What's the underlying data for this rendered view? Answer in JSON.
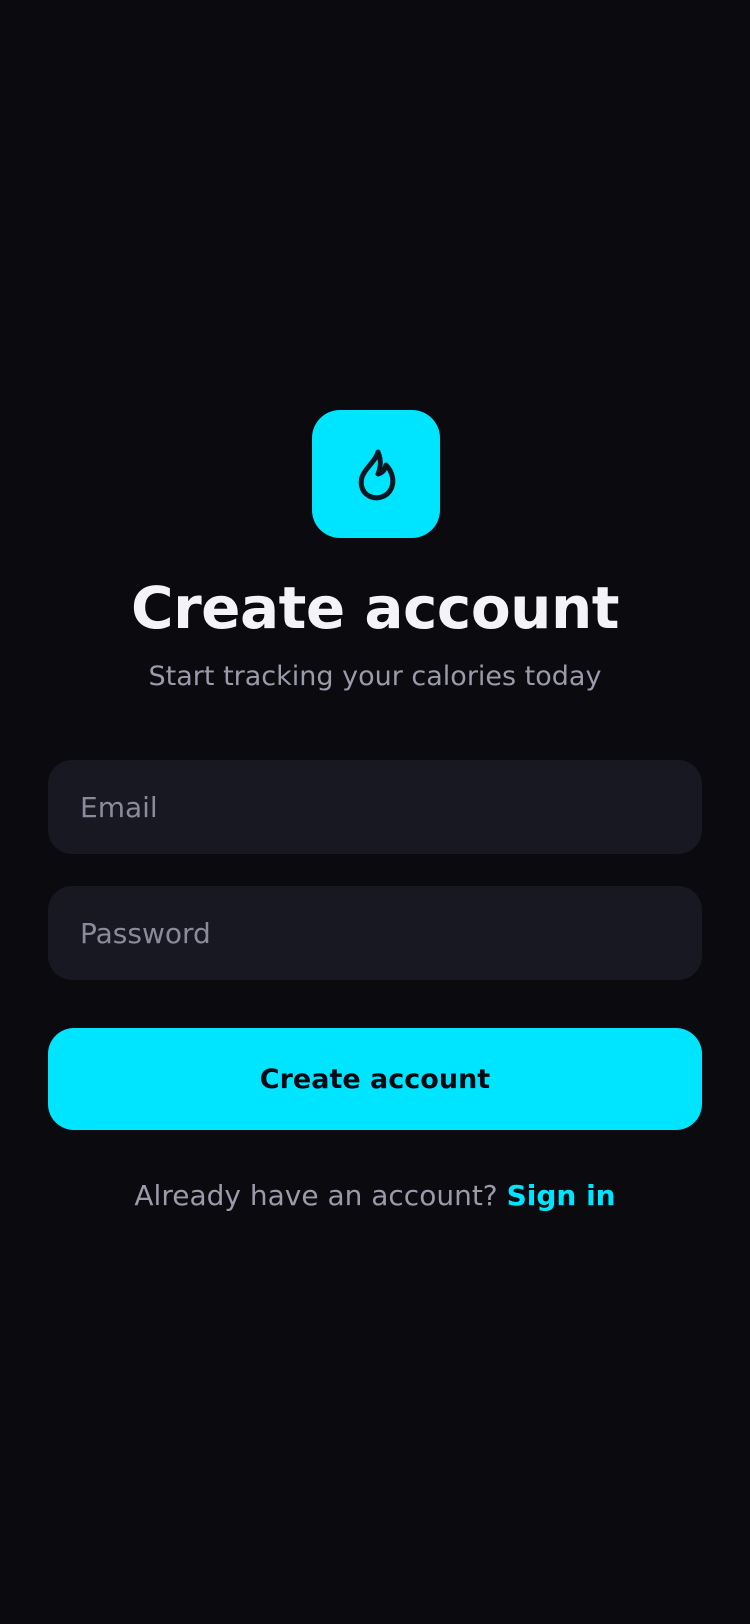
{
  "brand": {
    "accent_color": "#00e5ff",
    "background_color": "#0a0a0f",
    "logo_icon": "flame-icon"
  },
  "header": {
    "title": "Create account",
    "subtitle": "Start tracking your calories today"
  },
  "form": {
    "email": {
      "value": "",
      "placeholder": "Email"
    },
    "password": {
      "value": "",
      "placeholder": "Password"
    },
    "submit_label": "Create account"
  },
  "footer": {
    "prompt": "Already have an account?",
    "link_label": "Sign in"
  }
}
